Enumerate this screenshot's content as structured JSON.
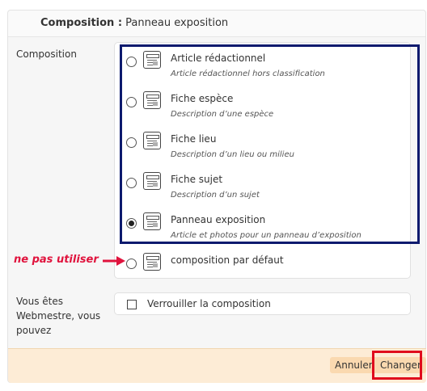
{
  "header": {
    "title_bold": "Composition :",
    "title_value": "Panneau exposition"
  },
  "labels": {
    "composition": "Composition",
    "webmaster": "Vous êtes Webmestre, vous pouvez"
  },
  "options": [
    {
      "title": "Article rédactionnel",
      "desc": "Article rédactionnel hors classification",
      "checked": false
    },
    {
      "title": "Fiche espèce",
      "desc": "Description d’une espèce",
      "checked": false
    },
    {
      "title": "Fiche lieu",
      "desc": "Description d’un lieu ou milieu",
      "checked": false
    },
    {
      "title": "Fiche sujet",
      "desc": "Description d’un sujet",
      "checked": false
    },
    {
      "title": "Panneau exposition",
      "desc": "Article et photos pour un panneau d’exposition",
      "checked": true
    }
  ],
  "default_option": {
    "title": "composition par défaut",
    "checked": false
  },
  "annotation": {
    "note": "ne pas utiliser"
  },
  "lock": {
    "label": "Verrouiller la composition",
    "checked": false
  },
  "footer": {
    "cancel_label": "Annuler",
    "submit_label": "Changer"
  },
  "colors": {
    "highlight_box": "#0d1a6e",
    "annotation": "#e0133d",
    "footer_bg": "#fdecd6"
  }
}
